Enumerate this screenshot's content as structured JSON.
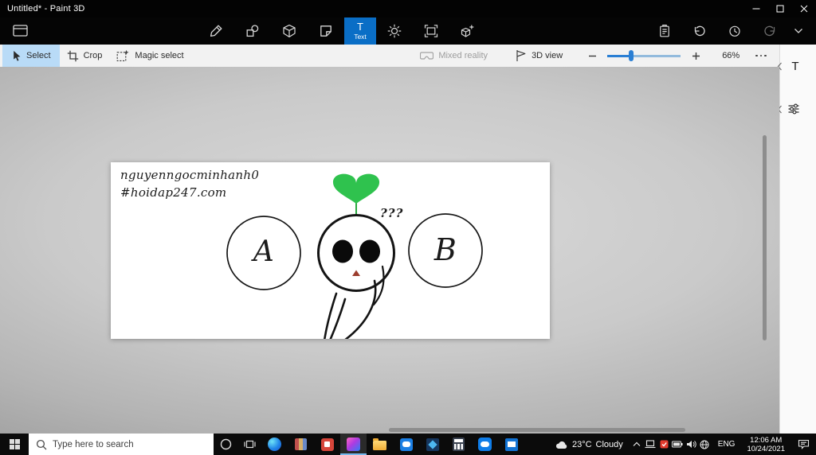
{
  "titlebar": {
    "title": "Untitled* - Paint 3D"
  },
  "toolbar": {
    "text_tool": {
      "icon_glyph": "T",
      "label": "Text"
    },
    "tool_names": [
      "menu",
      "brushes",
      "2d-shapes",
      "3d-shapes",
      "stickers",
      "text",
      "effects",
      "canvas",
      "3d-library",
      "paste",
      "undo",
      "history",
      "redo",
      "more"
    ]
  },
  "ribbon": {
    "select_label": "Select",
    "crop_label": "Crop",
    "magic_select_label": "Magic select",
    "mixed_reality_label": "Mixed reality",
    "view_3d_label": "3D view",
    "zoom_percent": "66%"
  },
  "sidepanel": {
    "text_tool_icon": "T"
  },
  "canvas": {
    "credit_line1": "nguyenngocminhanh0",
    "credit_line2": "#hoidap247.com",
    "option_a_label": "A",
    "option_b_label": "B",
    "question_marks": "???"
  },
  "taskbar": {
    "search_placeholder": "Type here to search",
    "weather": {
      "temperature": "23°C",
      "condition": "Cloudy"
    },
    "language": "ENG",
    "clock": {
      "time": "12:06 AM",
      "date": "10/24/2021"
    },
    "apps": [
      "edge",
      "books",
      "app-red",
      "paint-3d",
      "file-explorer",
      "chat-app",
      "photos",
      "calculator",
      "zalo",
      "mail"
    ]
  },
  "colors": {
    "accent_blue": "#0a6ec6",
    "select_highlight": "#b9dbf7",
    "sprout_green": "#2fc24e",
    "nose_red": "#9c3d2e",
    "slider_blue": "#2a7fd4"
  }
}
